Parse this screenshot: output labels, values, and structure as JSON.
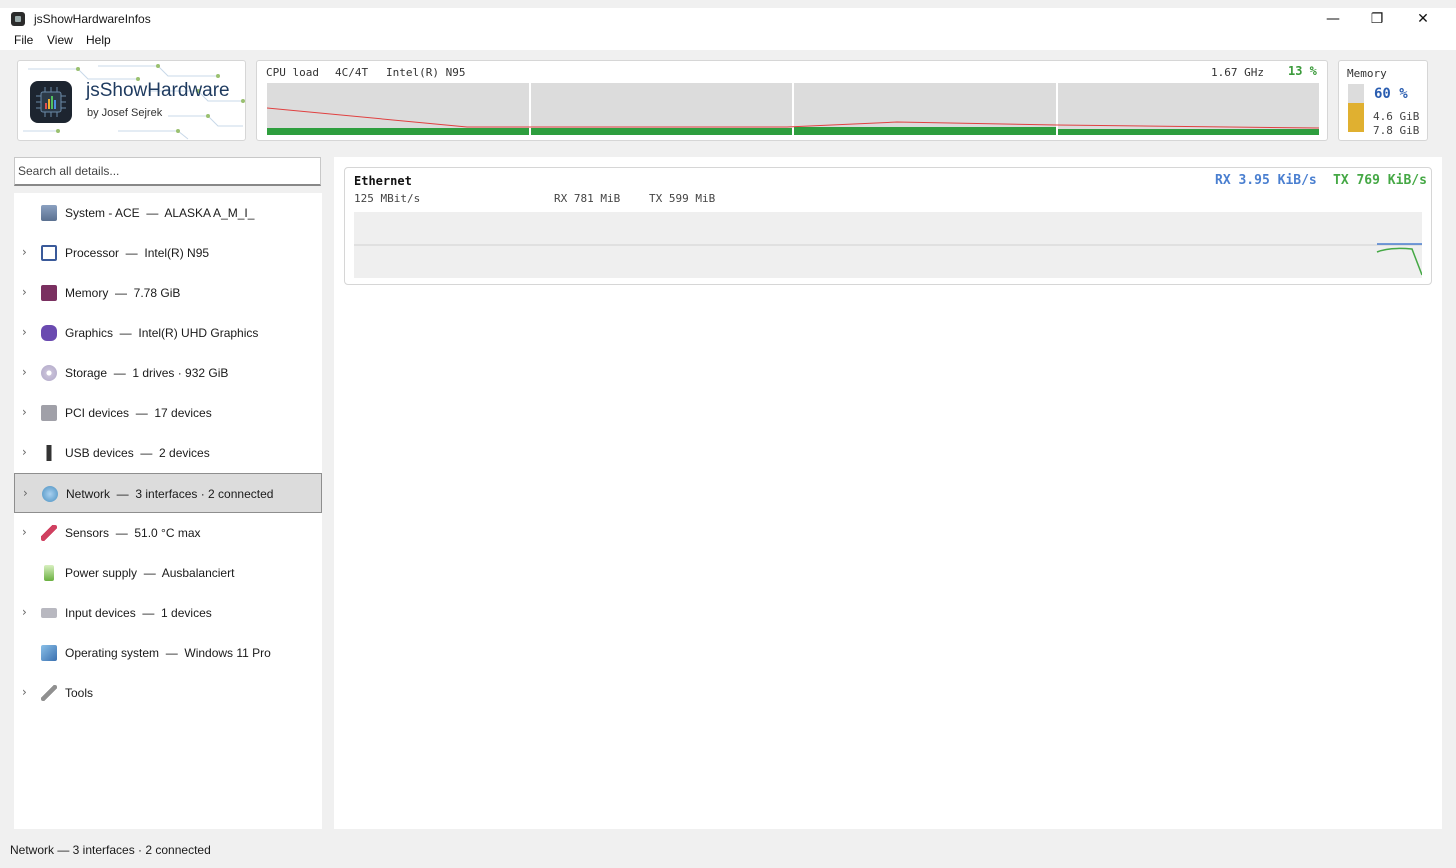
{
  "window": {
    "title": "jsShowHardwareInfos",
    "minimize_glyph": "—",
    "maximize_glyph": "❐",
    "close_glyph": "✕"
  },
  "menu": [
    "File",
    "View",
    "Help"
  ],
  "logo": {
    "title": "jsShowHardware",
    "subtitle": "by Josef Sejrek"
  },
  "cpu": {
    "label": "CPU load",
    "cores": "4C/4T",
    "model": "Intel(R) N95",
    "frequency": "1.67 GHz",
    "load": "13 %",
    "core_loads_percent": [
      14,
      14,
      15,
      12
    ],
    "colors": {
      "bar": "#2e9e3e",
      "line": "#e04040",
      "background": "#dcdcdc"
    }
  },
  "memory": {
    "title": "Memory",
    "percent_label": "60 %",
    "used_fraction": 0.6,
    "used": "4.6 GiB",
    "total": "7.8 GiB",
    "colors": {
      "fill": "#e0b030",
      "percent": "#2a5db0"
    }
  },
  "search": {
    "placeholder": "Search all details..."
  },
  "tree": {
    "items": [
      {
        "label": "System - ACE",
        "value": "ALASKA A_M_I_",
        "icon": "computer-icon",
        "expandable": false,
        "selected": false
      },
      {
        "label": "Processor",
        "value": "Intel(R) N95",
        "icon": "chip-icon",
        "expandable": true,
        "selected": false
      },
      {
        "label": "Memory",
        "value": "7.78 GiB",
        "icon": "floppy-icon",
        "expandable": true,
        "selected": false
      },
      {
        "label": "Graphics",
        "value": "Intel(R) UHD Graphics",
        "icon": "gamepad-icon",
        "expandable": true,
        "selected": false
      },
      {
        "label": "Storage",
        "value": "1 drives · 932 GiB",
        "icon": "disc-icon",
        "expandable": true,
        "selected": false
      },
      {
        "label": "PCI devices",
        "value": "17 devices",
        "icon": "pci-card-icon",
        "expandable": true,
        "selected": false
      },
      {
        "label": "USB devices",
        "value": "2 devices",
        "icon": "usb-plug-icon",
        "expandable": true,
        "selected": false
      },
      {
        "label": "Network",
        "value": "3 interfaces · 2 connected",
        "icon": "globe-network-icon",
        "expandable": true,
        "selected": true
      },
      {
        "label": "Sensors",
        "value": "51.0 °C max",
        "icon": "thermometer-icon",
        "expandable": true,
        "selected": false
      },
      {
        "label": "Power supply",
        "value": "Ausbalanciert",
        "icon": "battery-icon",
        "expandable": false,
        "selected": false
      },
      {
        "label": "Input devices",
        "value": "1 devices",
        "icon": "keyboard-icon",
        "expandable": true,
        "selected": false
      },
      {
        "label": "Operating system",
        "value": "Windows 11 Pro",
        "icon": "windows-icon",
        "expandable": false,
        "selected": false
      },
      {
        "label": "Tools",
        "value": "",
        "icon": "wrench-icon",
        "expandable": true,
        "selected": false
      }
    ],
    "separator": "—"
  },
  "network": {
    "name": "Ethernet",
    "link_speed": "125 MBit/s",
    "rx_total": "RX 781 MiB",
    "tx_total": "TX 599 MiB",
    "rx_rate": "RX 3.95 KiB/s",
    "tx_rate": "TX 769 KiB/s",
    "colors": {
      "rx": "#4a7fd0",
      "tx": "#45a845"
    }
  },
  "status": {
    "text": "Network — 3 interfaces · 2 connected"
  }
}
